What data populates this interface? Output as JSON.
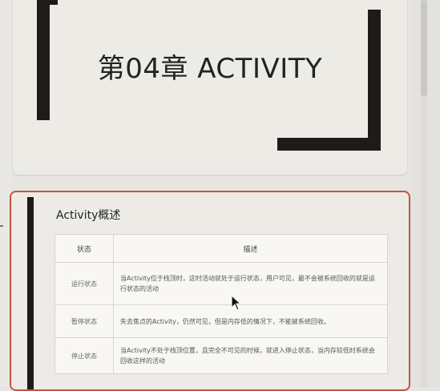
{
  "slide1": {
    "title": "第04章 ACTIVITY"
  },
  "slide2": {
    "title": "Activity概述",
    "table": {
      "headers": [
        "状态",
        "描述"
      ],
      "rows": [
        {
          "state": "运行状态",
          "desc": "当Activity位于栈顶时，这时活动就处于运行状态，用户可见，最不会被系统回收的就是运行状态的活动"
        },
        {
          "state": "暂停状态",
          "desc": "失去焦点的Activity，仍然可见，但是内存低的情况下，不能被系统回收。"
        },
        {
          "state": "停止状态",
          "desc": "当Activity不处于栈顶位置，且完全不可见的时候，就进入停止状态，当内存较低时系统会回收这样的活动"
        }
      ]
    }
  },
  "colors": {
    "accent_border": "#c4553f",
    "bar": "#1d1c1a",
    "slide_bg": "#ecebe6"
  }
}
